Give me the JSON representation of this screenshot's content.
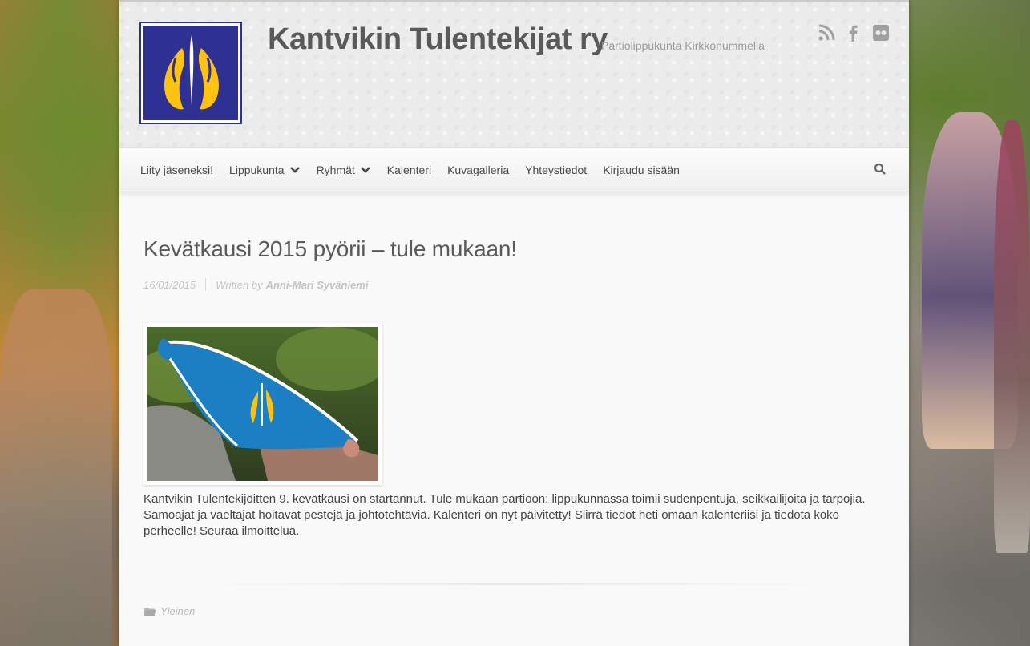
{
  "header": {
    "site_title": "Kantvikin Tulentekijat ry",
    "tagline": "Partiolippukunta Kirkkonummella",
    "logo_icon": "flame-emblem-logo",
    "brand_color": "#2e3192",
    "accent_color": "#ffc20e",
    "social": [
      "rss-icon",
      "facebook-icon",
      "flickr-icon"
    ]
  },
  "nav": {
    "items": [
      {
        "label": "Liity jäseneksi!",
        "dropdown": false
      },
      {
        "label": "Lippukunta",
        "dropdown": true
      },
      {
        "label": "Ryhmät",
        "dropdown": true
      },
      {
        "label": "Kalenteri",
        "dropdown": false
      },
      {
        "label": "Kuvagalleria",
        "dropdown": false
      },
      {
        "label": "Yhteystiedot",
        "dropdown": false
      },
      {
        "label": "Kirjaudu sisään",
        "dropdown": false
      }
    ],
    "search_icon": "search-icon"
  },
  "post": {
    "title": "Kevätkausi 2015 pyörii – tule mukaan!",
    "date": "16/01/2015",
    "written_by": "Written by",
    "author": "Anni-Mari Syväniemi",
    "body": "Kantvikin Tulentekijöitten 9. kevätkausi on startannut. Tule mukaan partioon: lippukunnassa toimii sudenpentuja, seikkailijoita ja tarpojia. Samoajat ja vaeltajat hoitavat pestejä ja johtotehtäviä.  Kalenteri on nyt päivitetty! Siirrä tiedot heti omaan kalenteriisi ja tiedota koko perheelle! Seuraa ilmoittelua.",
    "category": "Yleinen"
  }
}
